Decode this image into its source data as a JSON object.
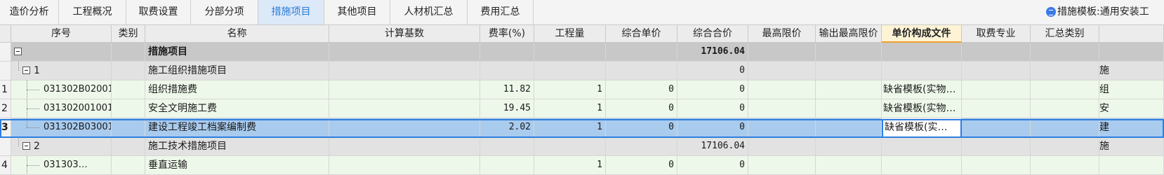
{
  "tabs": [
    {
      "label": "造价分析",
      "active": false
    },
    {
      "label": "工程概况",
      "active": false
    },
    {
      "label": "取费设置",
      "active": false
    },
    {
      "label": "分部分项",
      "active": false
    },
    {
      "label": "措施项目",
      "active": true
    },
    {
      "label": "其他项目",
      "active": false
    },
    {
      "label": "人材机汇总",
      "active": false
    },
    {
      "label": "费用汇总",
      "active": false
    }
  ],
  "template_label": "措施模板:通用安装工",
  "columns": [
    "序号",
    "类别",
    "名称",
    "计算基数",
    "费率(%)",
    "工程量",
    "综合单价",
    "综合合价",
    "最高限价",
    "输出最高限价",
    "单价构成文件",
    "取费专业",
    "汇总类别"
  ],
  "rows": [
    {
      "idx": "",
      "code": "",
      "category": "",
      "name": "措施项目",
      "base": "",
      "rate": "",
      "qty": "",
      "unit_price": "",
      "total": "17106.04",
      "file": "",
      "extra": ""
    },
    {
      "idx": "",
      "code": "1",
      "category": "",
      "name": "施工组织措施项目",
      "base": "",
      "rate": "",
      "qty": "",
      "unit_price": "",
      "total": "0",
      "file": "",
      "extra": "施"
    },
    {
      "idx": "1",
      "code": "031302B02001",
      "category": "",
      "name": "组织措施费",
      "base": "",
      "rate": "11.82",
      "qty": "1",
      "unit_price": "0",
      "total": "0",
      "file": "缺省模板(实物…",
      "extra": "组"
    },
    {
      "idx": "2",
      "code": "031302001001",
      "category": "",
      "name": "安全文明施工费",
      "base": "",
      "rate": "19.45",
      "qty": "1",
      "unit_price": "0",
      "total": "0",
      "file": "缺省模板(实物…",
      "extra": "安"
    },
    {
      "idx": "3",
      "code": "031302B03001",
      "category": "",
      "name": "建设工程竣工档案编制费",
      "base": "",
      "rate": "2.02",
      "qty": "1",
      "unit_price": "0",
      "total": "0",
      "file": "缺省模板(实…",
      "extra": "建"
    },
    {
      "idx": "",
      "code": "2",
      "category": "",
      "name": "施工技术措施项目",
      "base": "",
      "rate": "",
      "qty": "",
      "unit_price": "",
      "total": "17106.04",
      "file": "",
      "extra": "施"
    },
    {
      "idx": "4",
      "code": "031303…",
      "category": "",
      "name": "垂直运输",
      "base": "",
      "rate": "",
      "qty": "1",
      "unit_price": "0",
      "total": "0",
      "file": "",
      "extra": ""
    }
  ]
}
